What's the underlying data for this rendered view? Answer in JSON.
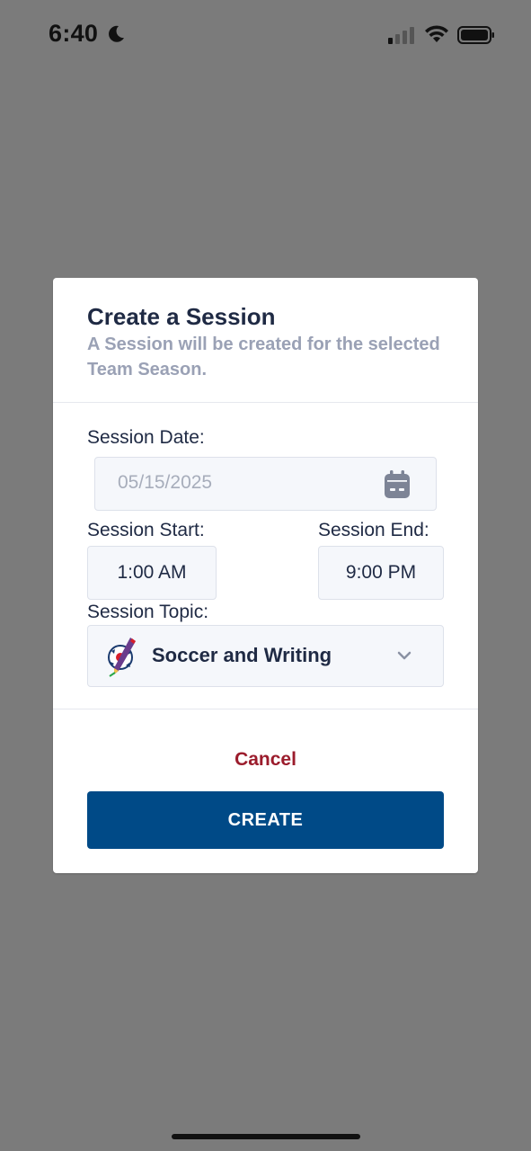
{
  "status_bar": {
    "time": "6:40",
    "icons": [
      "moon-icon",
      "cellular-signal-icon",
      "wifi-icon",
      "battery-icon"
    ]
  },
  "modal": {
    "title": "Create a Session",
    "subtitle": "A Session will be created for the selected Team Season.",
    "session_date": {
      "label": "Session Date:",
      "value": "05/15/2025",
      "icon": "calendar-icon"
    },
    "session_start": {
      "label": "Session Start:",
      "value": "1:00 AM"
    },
    "session_end": {
      "label": "Session End:",
      "value": "9:00 PM"
    },
    "session_topic": {
      "label": "Session Topic:",
      "value": "Soccer and Writing",
      "icon": "soccer-writing-icon"
    },
    "cancel_label": "Cancel",
    "create_label": "CREATE"
  },
  "colors": {
    "overlay": "#7b7b7b",
    "title": "#1f2a44",
    "subtitle": "#9aa1b5",
    "cancel": "#9b1c2c",
    "primary": "#004a87",
    "field_bg": "#f5f7fb"
  }
}
